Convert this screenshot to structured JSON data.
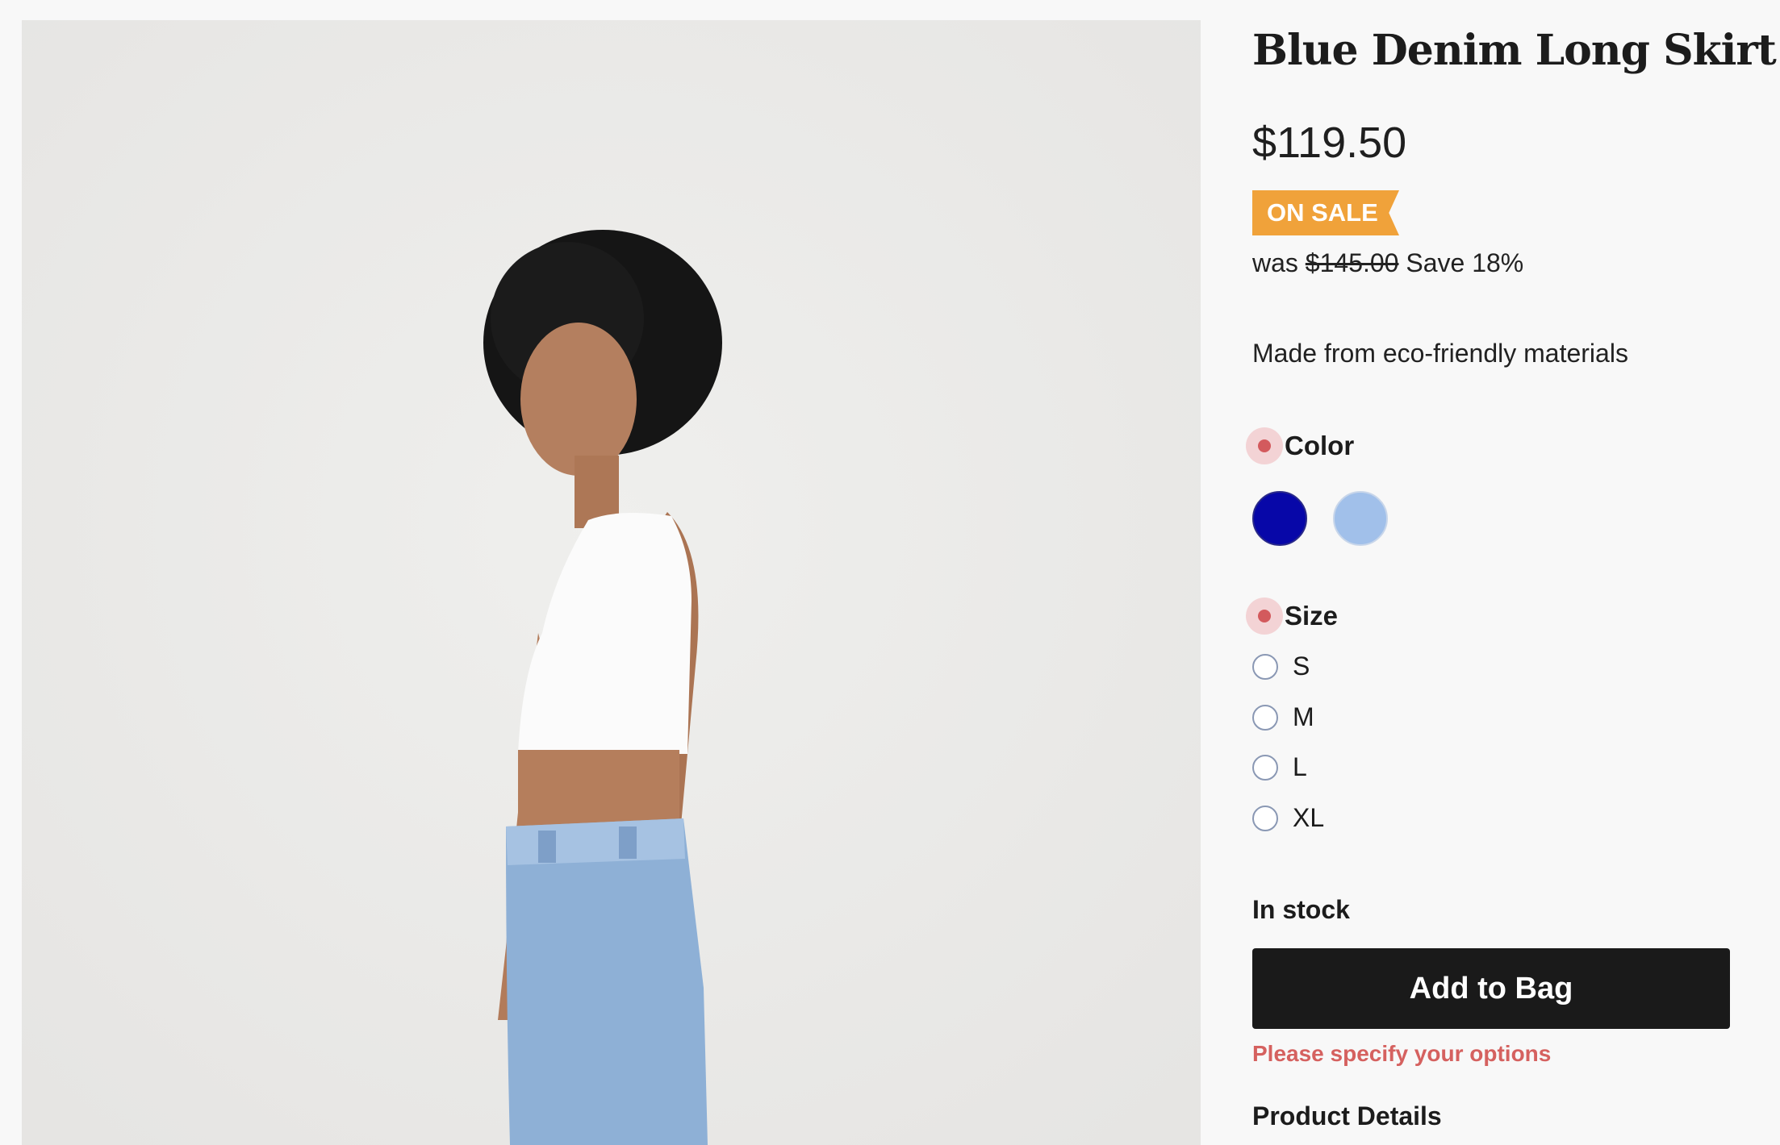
{
  "product": {
    "title": "Blue Denim Long Skirt",
    "price": "$119.50",
    "badge": "ON SALE",
    "was_prefix": "was",
    "was_price": "$145.00",
    "save_text": "Save 18%",
    "description": "Made from eco-friendly materials"
  },
  "options": {
    "color_label": "Color",
    "colors": [
      "#0707a8",
      "#a1c0ea"
    ],
    "size_label": "Size",
    "sizes": [
      "S",
      "M",
      "L",
      "XL"
    ]
  },
  "stock_status": "In stock",
  "add_to_bag_label": "Add to Bag",
  "error_message": "Please specify your options",
  "product_details_heading": "Product Details",
  "colors": {
    "badge_bg": "#f0a23a",
    "button_bg": "#1a1a1a",
    "error": "#d5615f",
    "required_dot": "#d35a5d"
  }
}
